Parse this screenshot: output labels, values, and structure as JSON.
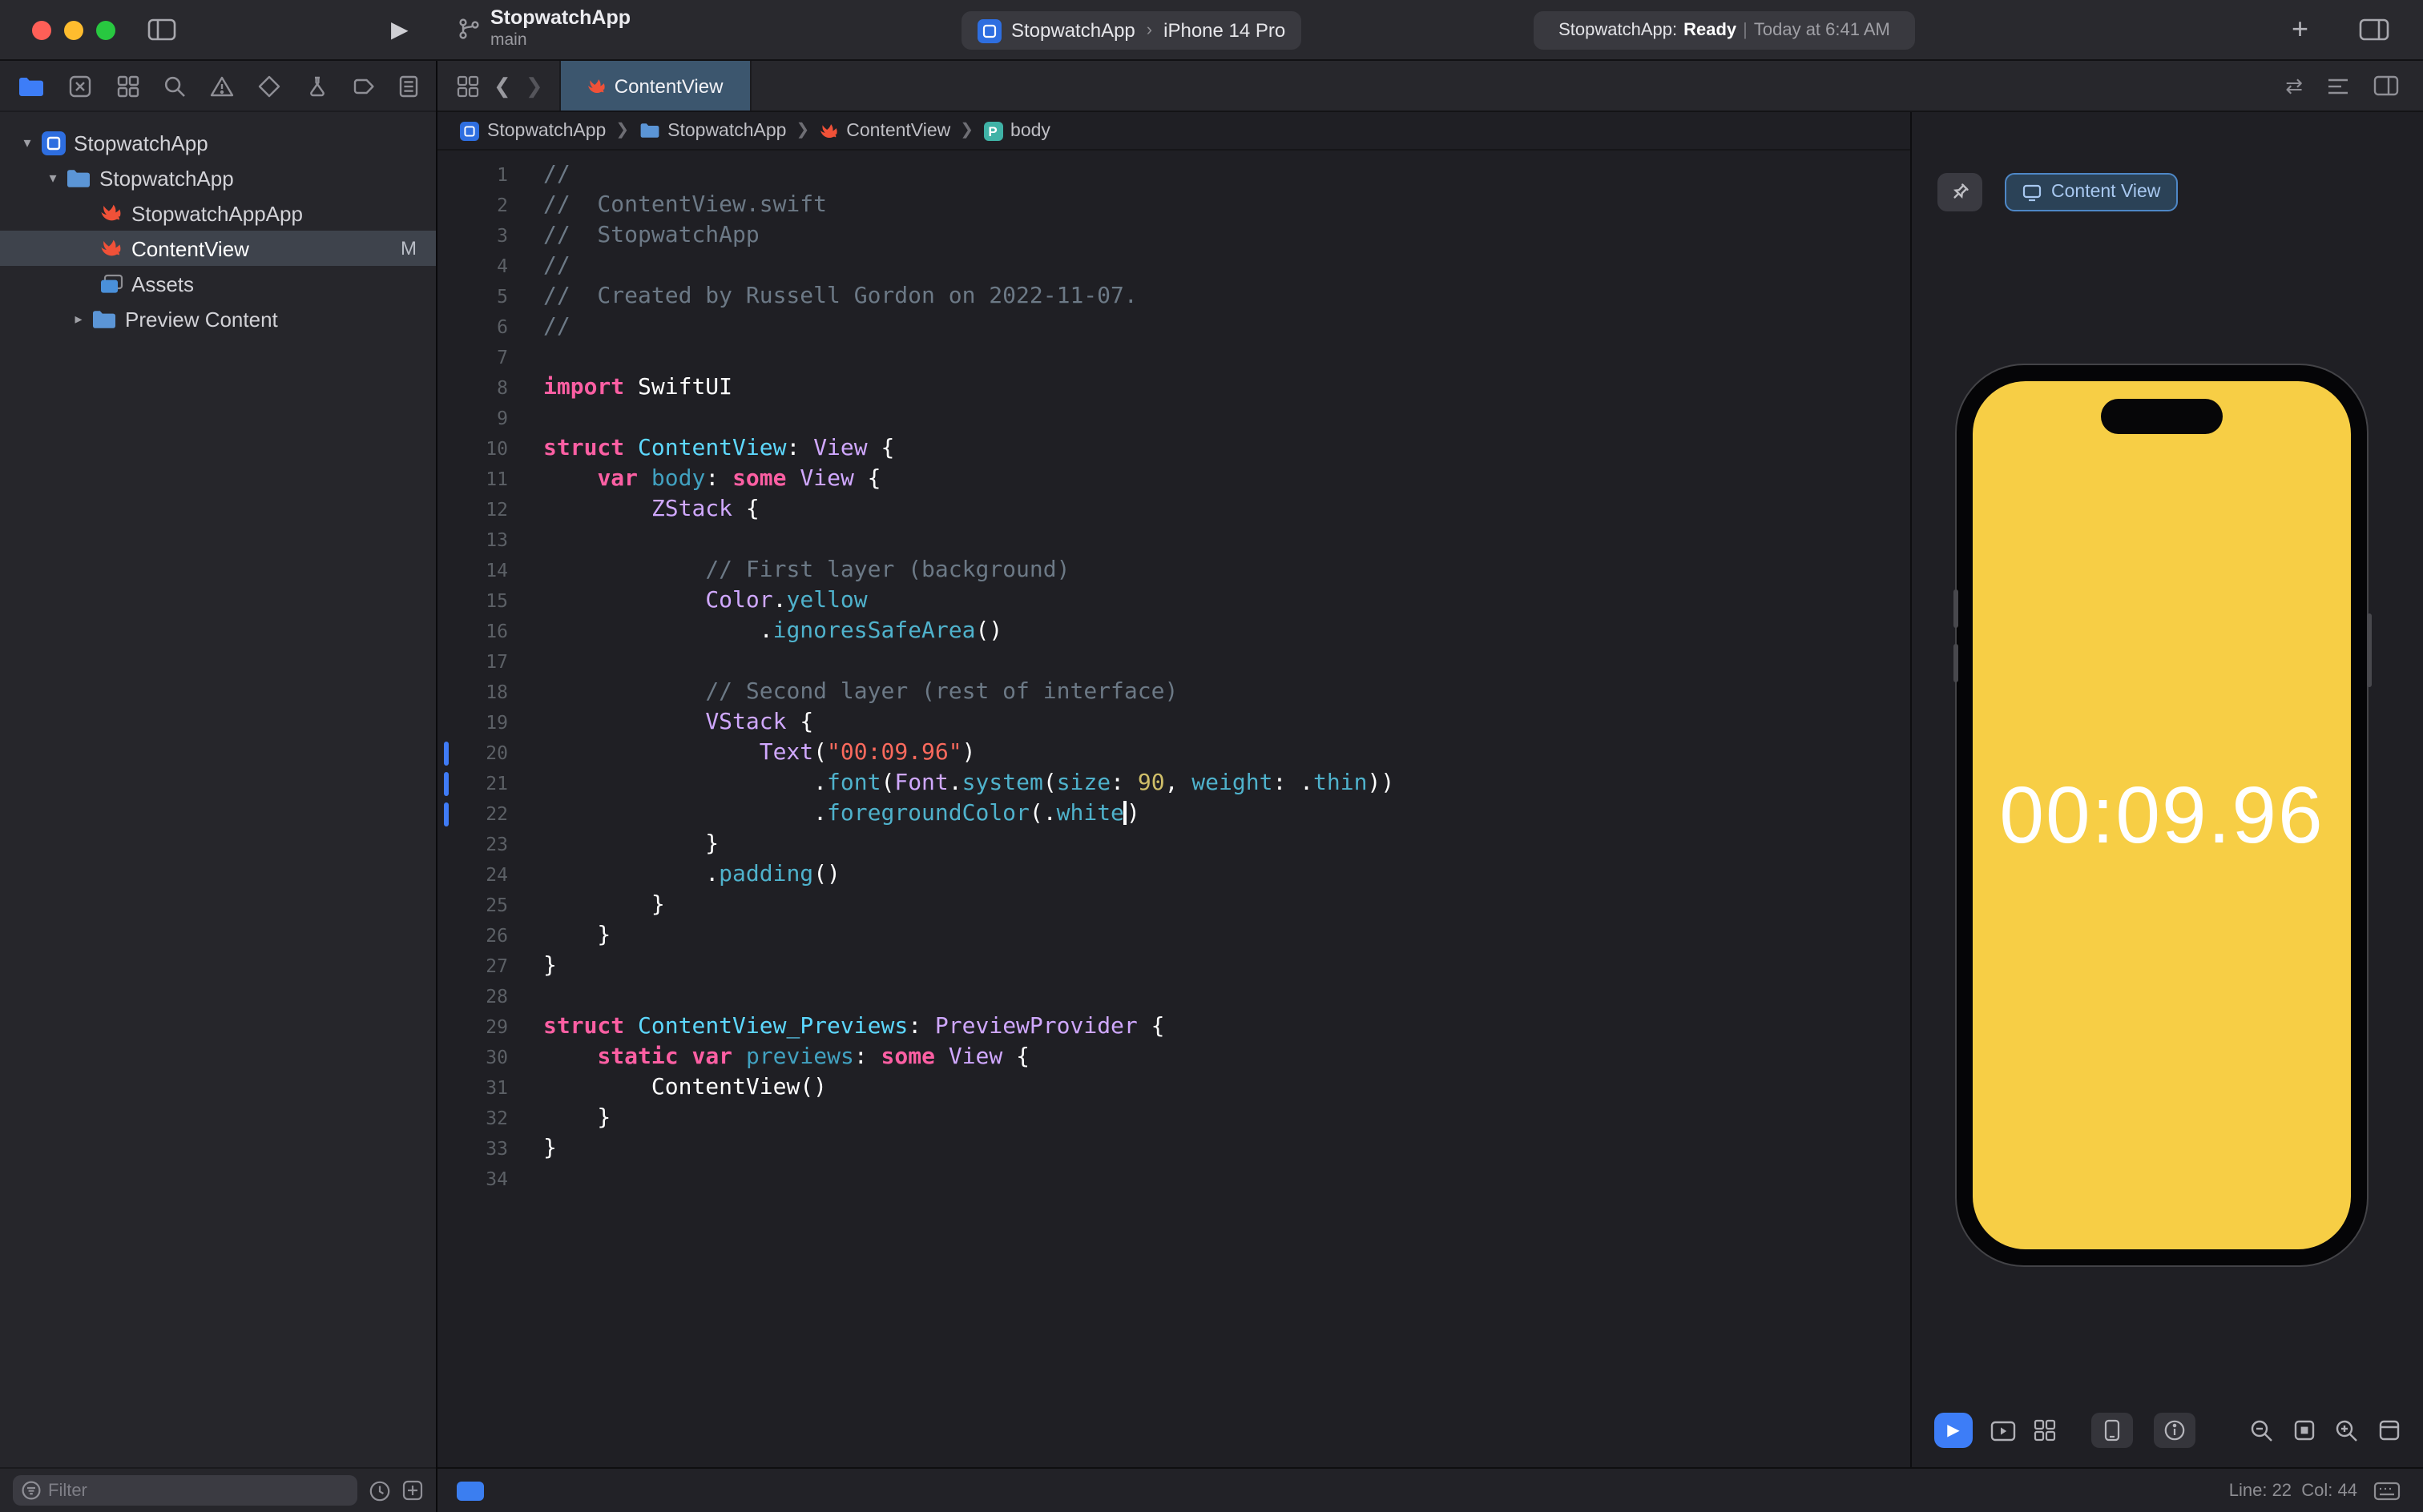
{
  "titlebar": {
    "project": "StopwatchApp",
    "branch": "main",
    "scheme_app": "StopwatchApp",
    "scheme_device": "iPhone 14 Pro",
    "status_app": "StopwatchApp:",
    "status_state": "Ready",
    "status_sep": "|",
    "status_time": "Today at 6:41 AM"
  },
  "navigator": {
    "icon_strip": [
      "project-navigator",
      "source-control-navigator",
      "symbol-navigator",
      "find-navigator",
      "issue-navigator",
      "test-navigator",
      "debug-navigator",
      "breakpoint-navigator",
      "report-navigator"
    ],
    "items": [
      {
        "label": "StopwatchApp",
        "type": "project",
        "expanded": true
      },
      {
        "label": "StopwatchApp",
        "type": "group",
        "expanded": true
      },
      {
        "label": "StopwatchAppApp",
        "type": "swift-file"
      },
      {
        "label": "ContentView",
        "type": "swift-file",
        "selected": true,
        "badge": "M"
      },
      {
        "label": "Assets",
        "type": "asset-catalog"
      },
      {
        "label": "Preview Content",
        "type": "group",
        "collapsed": true
      }
    ],
    "filter_placeholder": "Filter"
  },
  "tabbar": {
    "tabs": [
      {
        "label": "ContentView",
        "active": true
      }
    ]
  },
  "breadcrumb": {
    "items": [
      "StopwatchApp",
      "StopwatchApp",
      "ContentView",
      "body"
    ]
  },
  "editor": {
    "changed_lines": [
      20,
      21,
      22
    ],
    "lines": [
      [
        [
          "c",
          "//"
        ]
      ],
      [
        [
          "c",
          "//  ContentView.swift"
        ]
      ],
      [
        [
          "c",
          "//  StopwatchApp"
        ]
      ],
      [
        [
          "c",
          "//"
        ]
      ],
      [
        [
          "c",
          "//  Created by Russell Gordon on 2022-11-07."
        ]
      ],
      [
        [
          "c",
          "//"
        ]
      ],
      [],
      [
        [
          "k",
          "import"
        ],
        [
          "p",
          " SwiftUI"
        ]
      ],
      [],
      [
        [
          "k",
          "struct"
        ],
        [
          "p",
          " "
        ],
        [
          "d",
          "ContentView"
        ],
        [
          "p",
          ": "
        ],
        [
          "t",
          "View"
        ],
        [
          "p",
          " {"
        ]
      ],
      [
        [
          "p",
          "    "
        ],
        [
          "k",
          "var"
        ],
        [
          "p",
          " "
        ],
        [
          "o",
          "body"
        ],
        [
          "p",
          ": "
        ],
        [
          "k",
          "some"
        ],
        [
          "p",
          " "
        ],
        [
          "t",
          "View"
        ],
        [
          "p",
          " {"
        ]
      ],
      [
        [
          "p",
          "        "
        ],
        [
          "t",
          "ZStack"
        ],
        [
          "p",
          " {"
        ]
      ],
      [],
      [
        [
          "p",
          "            "
        ],
        [
          "c",
          "// First layer (background)"
        ]
      ],
      [
        [
          "p",
          "            "
        ],
        [
          "t",
          "Color"
        ],
        [
          "p",
          "."
        ],
        [
          "m",
          "yellow"
        ]
      ],
      [
        [
          "p",
          "                ."
        ],
        [
          "m",
          "ignoresSafeArea"
        ],
        [
          "p",
          "()"
        ]
      ],
      [],
      [
        [
          "p",
          "            "
        ],
        [
          "c",
          "// Second layer (rest of interface)"
        ]
      ],
      [
        [
          "p",
          "            "
        ],
        [
          "t",
          "VStack"
        ],
        [
          "p",
          " {"
        ]
      ],
      [
        [
          "p",
          "                "
        ],
        [
          "t",
          "Text"
        ],
        [
          "p",
          "("
        ],
        [
          "s",
          "\"00:09.96\""
        ],
        [
          "p",
          ")"
        ]
      ],
      [
        [
          "p",
          "                    ."
        ],
        [
          "m",
          "font"
        ],
        [
          "p",
          "("
        ],
        [
          "t",
          "Font"
        ],
        [
          "p",
          "."
        ],
        [
          "m",
          "system"
        ],
        [
          "p",
          "("
        ],
        [
          "m",
          "size"
        ],
        [
          "p",
          ": "
        ],
        [
          "n",
          "90"
        ],
        [
          "p",
          ", "
        ],
        [
          "m",
          "weight"
        ],
        [
          "p",
          ": ."
        ],
        [
          "m",
          "thin"
        ],
        [
          "p",
          "))"
        ]
      ],
      [
        [
          "p",
          "                    ."
        ],
        [
          "m",
          "foregroundColor"
        ],
        [
          "p",
          "(."
        ],
        [
          "m",
          "white"
        ],
        [
          "caret",
          ""
        ],
        [
          "p",
          ")"
        ]
      ],
      [
        [
          "p",
          "            }"
        ]
      ],
      [
        [
          "p",
          "            ."
        ],
        [
          "m",
          "padding"
        ],
        [
          "p",
          "()"
        ]
      ],
      [
        [
          "p",
          "        }"
        ]
      ],
      [
        [
          "p",
          "    }"
        ]
      ],
      [
        [
          "p",
          "}"
        ]
      ],
      [],
      [
        [
          "k",
          "struct"
        ],
        [
          "p",
          " "
        ],
        [
          "d",
          "ContentView_Previews"
        ],
        [
          "p",
          ": "
        ],
        [
          "t",
          "PreviewProvider"
        ],
        [
          "p",
          " {"
        ]
      ],
      [
        [
          "p",
          "    "
        ],
        [
          "k",
          "static"
        ],
        [
          "p",
          " "
        ],
        [
          "k",
          "var"
        ],
        [
          "p",
          " "
        ],
        [
          "o",
          "previews"
        ],
        [
          "p",
          ": "
        ],
        [
          "k",
          "some"
        ],
        [
          "p",
          " "
        ],
        [
          "t",
          "View"
        ],
        [
          "p",
          " {"
        ]
      ],
      [
        [
          "p",
          "        "
        ],
        [
          "pt",
          "ContentView"
        ],
        [
          "p",
          "()"
        ]
      ],
      [
        [
          "p",
          "    }"
        ]
      ],
      [
        [
          "p",
          "}"
        ]
      ],
      []
    ]
  },
  "canvas": {
    "button_label": "Content View",
    "timer": "00:09.96"
  },
  "statusbar": {
    "line_col": "Line: 22  Col: 44"
  },
  "colors": {
    "accent": "#3D7DF7",
    "screen-yellow": "#F7CE45",
    "swift-orange": "#F05138",
    "kw": "#FC5FA3",
    "cmt": "#6C7986",
    "str": "#FC6A5D",
    "num": "#D0BF69",
    "type": "#D0A8FF",
    "decl": "#5DD8FF",
    "declo": "#41A1C0",
    "member": "#4FB2CC",
    "tab-active": "#3C566E",
    "selection": "#3E434C"
  }
}
